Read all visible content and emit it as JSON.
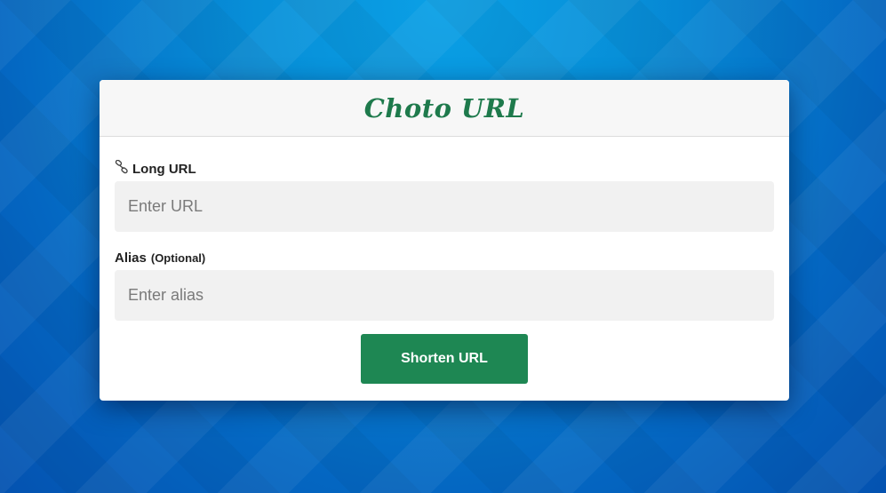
{
  "app": {
    "title": "Choto URL"
  },
  "form": {
    "long_url": {
      "label": "Long URL",
      "icon": "link-icon",
      "placeholder": "Enter URL",
      "value": ""
    },
    "alias": {
      "label": "Alias",
      "optional_text": "(Optional)",
      "placeholder": "Enter alias",
      "value": ""
    },
    "submit_label": "Shorten URL"
  },
  "colors": {
    "brand": "#1e7a4c",
    "button": "#1e8753",
    "background": "#0577cc"
  }
}
